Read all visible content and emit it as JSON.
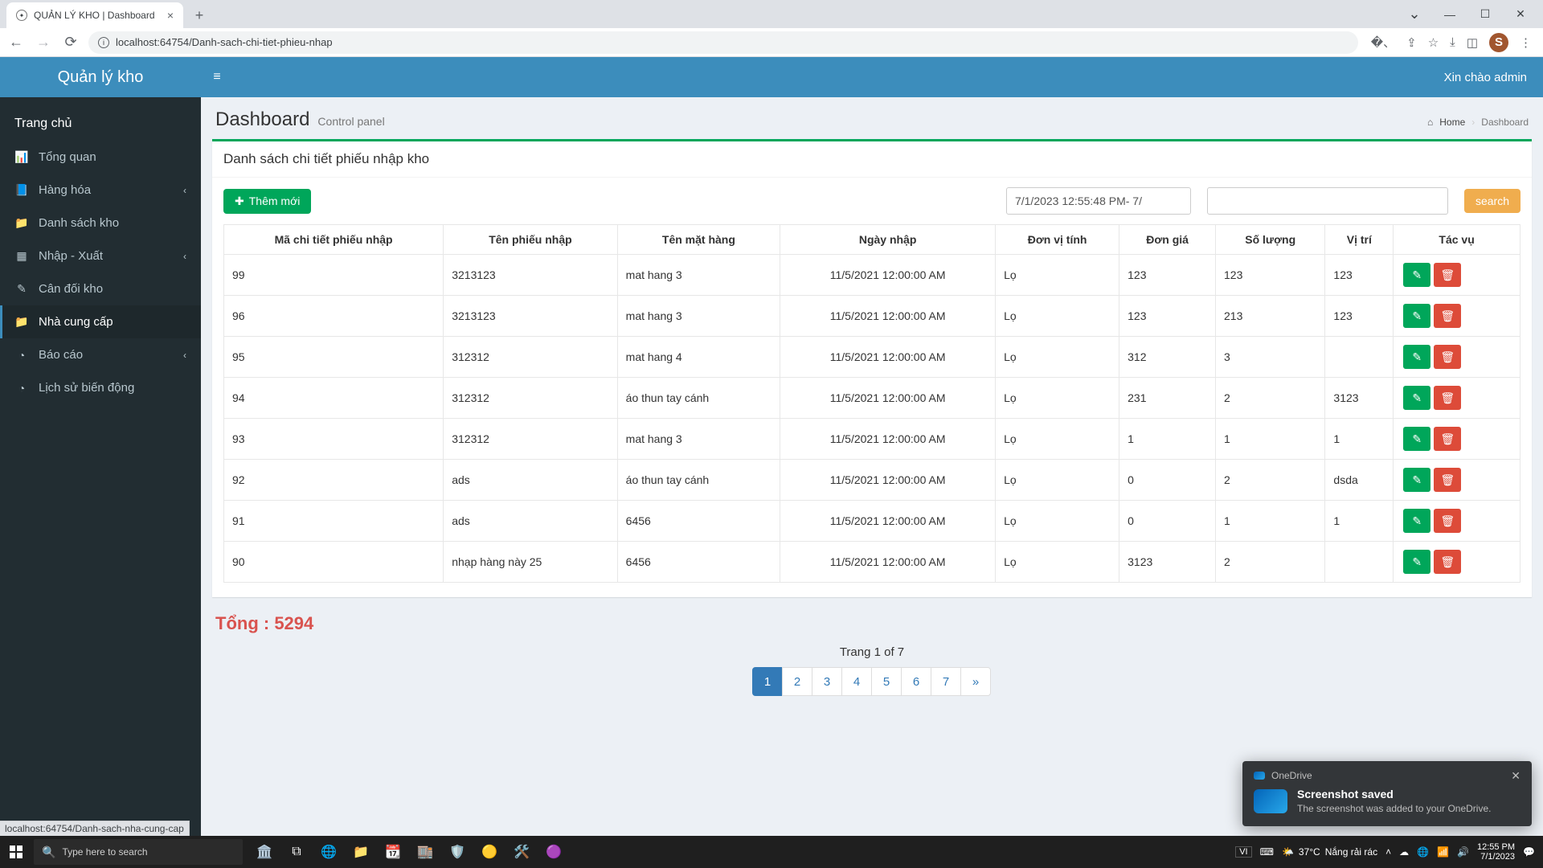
{
  "browser": {
    "tab_title": "QUẢN LÝ KHO | Dashboard",
    "url": "localhost:64754/Danh-sach-chi-tiet-phieu-nhap",
    "status_link": "localhost:64754/Danh-sach-nha-cung-cap",
    "avatar_initial": "S"
  },
  "header": {
    "logo": "Quản lý kho",
    "greeting": "Xin chào admin"
  },
  "sidebar": {
    "home": "Trang chủ",
    "items": [
      {
        "icon": "📊",
        "label": "Tổng quan",
        "exp": false
      },
      {
        "icon": "📘",
        "label": "Hàng hóa",
        "exp": true
      },
      {
        "icon": "📁",
        "label": "Danh sách kho",
        "exp": false
      },
      {
        "icon": "▦",
        "label": "Nhập - Xuất",
        "exp": true
      },
      {
        "icon": "✎",
        "label": "Cân đối kho",
        "exp": false
      },
      {
        "icon": "📁",
        "label": "Nhà cung cấp",
        "exp": false,
        "active": true
      },
      {
        "icon": "◔",
        "label": "Báo cáo",
        "exp": true
      },
      {
        "icon": "◔",
        "label": "Lịch sử biến động",
        "exp": false
      }
    ]
  },
  "page": {
    "title": "Dashboard",
    "subtitle": "Control panel",
    "breadcrumb_home": "Home",
    "breadcrumb_current": "Dashboard",
    "box_title": "Danh sách chi tiết phiếu nhập kho",
    "add_label": "Thêm mới",
    "date_filter_value": "7/1/2023 12:55:48 PM- 7/",
    "search_btn": "search",
    "total_label": "Tổng : ",
    "total_value": "5294",
    "pager_caption": "Trang 1 of 7",
    "pager_pages": [
      "1",
      "2",
      "3",
      "4",
      "5",
      "6",
      "7",
      "»"
    ],
    "pager_active": "1"
  },
  "table": {
    "headers": [
      "Mã chi tiết phiếu nhập",
      "Tên phiếu nhập",
      "Tên mặt hàng",
      "Ngày nhập",
      "Đơn vị tính",
      "Đơn giá",
      "Số lượng",
      "Vị trí",
      "Tác vụ"
    ],
    "rows": [
      {
        "id": "99",
        "phieu": "3213123",
        "mat": "mat hang 3",
        "ngay": "11/5/2021 12:00:00 AM",
        "dv": "Lọ",
        "gia": "123",
        "sl": "123",
        "vt": "123"
      },
      {
        "id": "96",
        "phieu": "3213123",
        "mat": "mat hang 3",
        "ngay": "11/5/2021 12:00:00 AM",
        "dv": "Lọ",
        "gia": "123",
        "sl": "213",
        "vt": "123"
      },
      {
        "id": "95",
        "phieu": "312312",
        "mat": "mat hang 4",
        "ngay": "11/5/2021 12:00:00 AM",
        "dv": "Lọ",
        "gia": "312",
        "sl": "3",
        "vt": ""
      },
      {
        "id": "94",
        "phieu": "312312",
        "mat": "áo thun tay cánh",
        "ngay": "11/5/2021 12:00:00 AM",
        "dv": "Lọ",
        "gia": "231",
        "sl": "2",
        "vt": "3123"
      },
      {
        "id": "93",
        "phieu": "312312",
        "mat": "mat hang 3",
        "ngay": "11/5/2021 12:00:00 AM",
        "dv": "Lọ",
        "gia": "1",
        "sl": "1",
        "vt": "1"
      },
      {
        "id": "92",
        "phieu": "ads",
        "mat": "áo thun tay cánh",
        "ngay": "11/5/2021 12:00:00 AM",
        "dv": "Lọ",
        "gia": "0",
        "sl": "2",
        "vt": "dsda"
      },
      {
        "id": "91",
        "phieu": "ads",
        "mat": "6456",
        "ngay": "11/5/2021 12:00:00 AM",
        "dv": "Lọ",
        "gia": "0",
        "sl": "1",
        "vt": "1"
      },
      {
        "id": "90",
        "phieu": "nhạp hàng này 25",
        "mat": "6456",
        "ngay": "11/5/2021 12:00:00 AM",
        "dv": "Lọ",
        "gia": "3123",
        "sl": "2",
        "vt": ""
      }
    ]
  },
  "toast": {
    "app": "OneDrive",
    "title": "Screenshot saved",
    "body": "The screenshot was added to your OneDrive."
  },
  "taskbar": {
    "search_placeholder": "Type here to search",
    "lang": "VI",
    "weather_temp": "37°C",
    "weather_text": "Nắng rải rác",
    "time": "12:55 PM",
    "date": "7/1/2023"
  }
}
